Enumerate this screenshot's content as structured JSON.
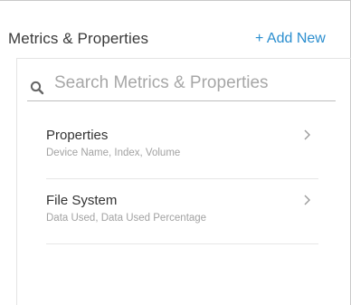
{
  "header": {
    "title": "Metrics & Properties",
    "add_label": "+ Add New"
  },
  "search": {
    "placeholder": "Search Metrics & Properties",
    "value": "",
    "icon": "search-icon"
  },
  "items": [
    {
      "title": "Properties",
      "subtitle": "Device Name, Index, Volume",
      "icon": "chevron-right-icon"
    },
    {
      "title": "File System",
      "subtitle": "Data Used, Data Used Percentage",
      "icon": "chevron-right-icon"
    }
  ],
  "colors": {
    "accent": "#2b8ecf",
    "text": "#333333",
    "muted": "#a2a2a2",
    "divider": "#e6e6e6"
  }
}
